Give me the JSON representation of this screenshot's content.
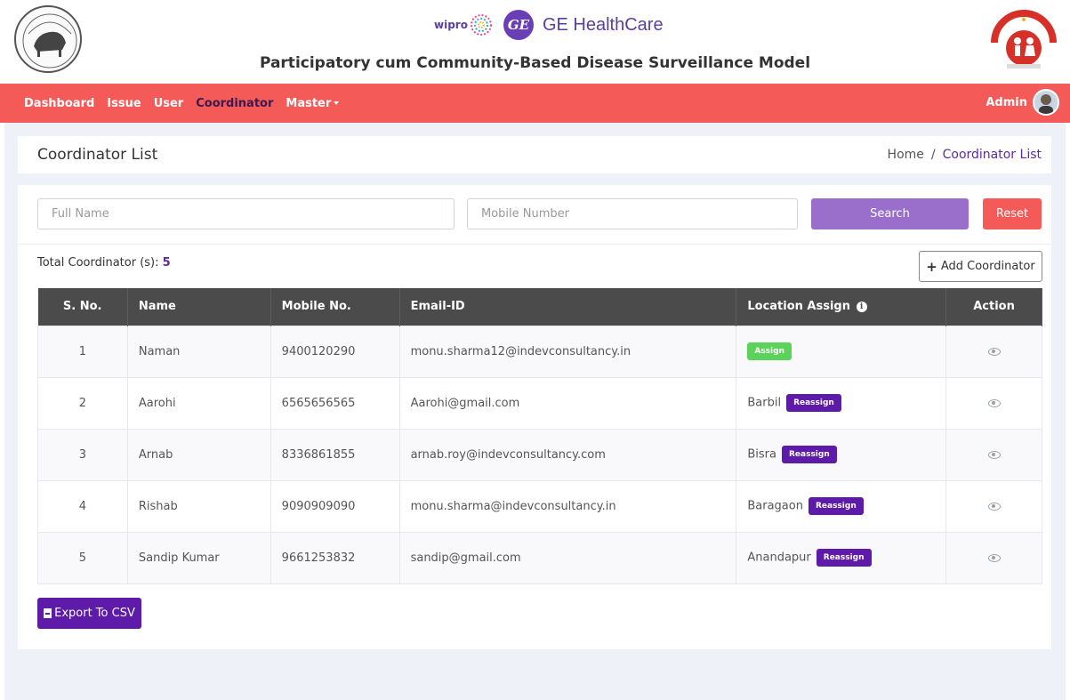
{
  "header": {
    "title": "Participatory cum Community-Based Disease Surveillance Model",
    "wipro_label": "wipro",
    "ge_label": "GE HealthCare",
    "ge_mark": "GE"
  },
  "nav": {
    "items": [
      {
        "label": "Dashboard",
        "active": false
      },
      {
        "label": "Issue",
        "active": false
      },
      {
        "label": "User",
        "active": false
      },
      {
        "label": "Coordinator",
        "active": true
      },
      {
        "label": "Master",
        "active": false,
        "dropdown": true
      }
    ],
    "admin_label": "Admin",
    "bg_color": "#f45a57"
  },
  "page": {
    "title": "Coordinator List",
    "breadcrumb": {
      "home": "Home",
      "separator": "/",
      "current": "Coordinator List"
    }
  },
  "filters": {
    "fullname_placeholder": "Full Name",
    "mobile_placeholder": "Mobile Number",
    "search_label": "Search",
    "reset_label": "Reset"
  },
  "summary": {
    "total_label": "Total Coordinator (s):",
    "total_count": "5",
    "add_label": "Add Coordinator"
  },
  "table": {
    "columns": [
      "S. No.",
      "Name",
      "Mobile No.",
      "Email-ID",
      "Location Assign",
      "Action"
    ],
    "rows": [
      {
        "sno": "1",
        "name": "Naman",
        "mobile": "9400120290",
        "email": "monu.sharma12@indevconsultancy.in",
        "location": "",
        "button": "Assign"
      },
      {
        "sno": "2",
        "name": "Aarohi",
        "mobile": "6565656565",
        "email": "Aarohi@gmail.com",
        "location": "Barbil",
        "button": "Reassign"
      },
      {
        "sno": "3",
        "name": "Arnab",
        "mobile": "8336861855",
        "email": "arnab.roy@indevconsultancy.com",
        "location": "Bisra",
        "button": "Reassign"
      },
      {
        "sno": "4",
        "name": "Rishab",
        "mobile": "9090909090",
        "email": "monu.sharma@indevconsultancy.in",
        "location": "Baragaon",
        "button": "Reassign"
      },
      {
        "sno": "5",
        "name": "Sandip Kumar",
        "mobile": "9661253832",
        "email": "sandip@gmail.com",
        "location": "Anandapur",
        "button": "Reassign"
      }
    ]
  },
  "export": {
    "label": "Export To CSV"
  },
  "icons": {
    "action": "eye-icon",
    "info": "info-icon",
    "add": "plus-icon",
    "export": "file-icon"
  },
  "colors": {
    "accent_purple": "#5e1aa8",
    "search_purple": "#9a6ecb",
    "assign_green": "#5bd35b",
    "table_header": "#4b4b4b"
  }
}
